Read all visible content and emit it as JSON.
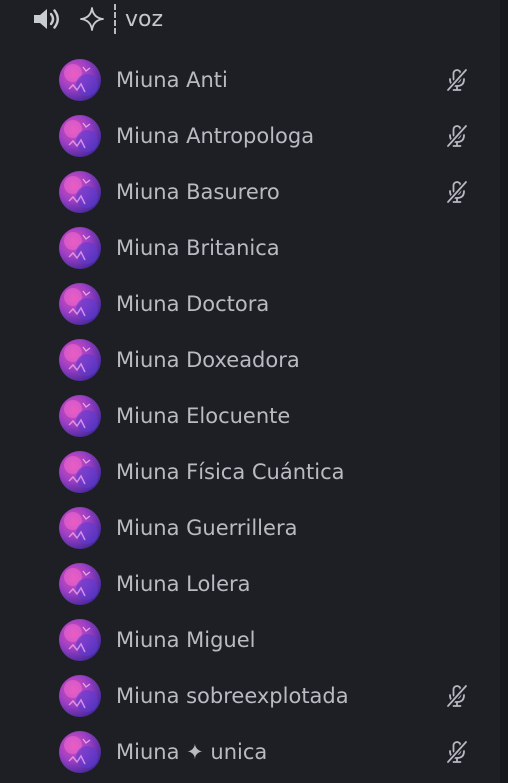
{
  "channel": {
    "name": "voz",
    "speaker_icon": "speaker-icon",
    "channel_icon": "sparkle-icon"
  },
  "colors": {
    "background": "#1e1f24",
    "text": "#b8bcc2",
    "icon": "#b5bac1"
  },
  "users": [
    {
      "name": "Miuna Anti",
      "muted": true
    },
    {
      "name": "Miuna Antropologa",
      "muted": true
    },
    {
      "name": "Miuna Basurero",
      "muted": true
    },
    {
      "name": "Miuna Britanica",
      "muted": false
    },
    {
      "name": "Miuna Doctora",
      "muted": false
    },
    {
      "name": "Miuna Doxeadora",
      "muted": false
    },
    {
      "name": "Miuna Elocuente",
      "muted": false
    },
    {
      "name": "Miuna Física Cuántica",
      "muted": false
    },
    {
      "name": "Miuna Guerrillera",
      "muted": false
    },
    {
      "name": "Miuna Lolera",
      "muted": false
    },
    {
      "name": "Miuna Miguel",
      "muted": false
    },
    {
      "name": "Miuna sobreexplotada",
      "muted": true
    },
    {
      "name": "Miuna ✦ unica",
      "muted": true
    }
  ]
}
